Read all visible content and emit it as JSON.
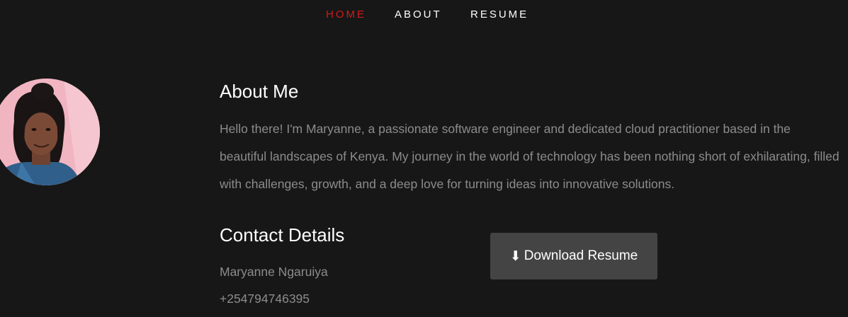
{
  "nav": {
    "items": [
      {
        "label": "HOME",
        "active": true
      },
      {
        "label": "ABOUT",
        "active": false
      },
      {
        "label": "RESUME",
        "active": false
      }
    ]
  },
  "colors": {
    "background": "#171717",
    "active_nav": "#d11a1a",
    "body_text": "#8c8c8c",
    "button_bg": "#444444"
  },
  "about": {
    "title": "About Me",
    "text": "Hello there! I'm Maryanne, a passionate software engineer and dedicated cloud practitioner based in the beautiful landscapes of Kenya. My journey in the world of technology has been nothing short of exhilarating, filled with challenges, growth, and a deep love for turning ideas into innovative solutions."
  },
  "contact": {
    "title": "Contact Details",
    "name": "Maryanne Ngaruiya",
    "phone": "+254794746395"
  },
  "download": {
    "icon": "download-arrow-icon",
    "glyph": "⬇",
    "label": "Download Resume"
  }
}
